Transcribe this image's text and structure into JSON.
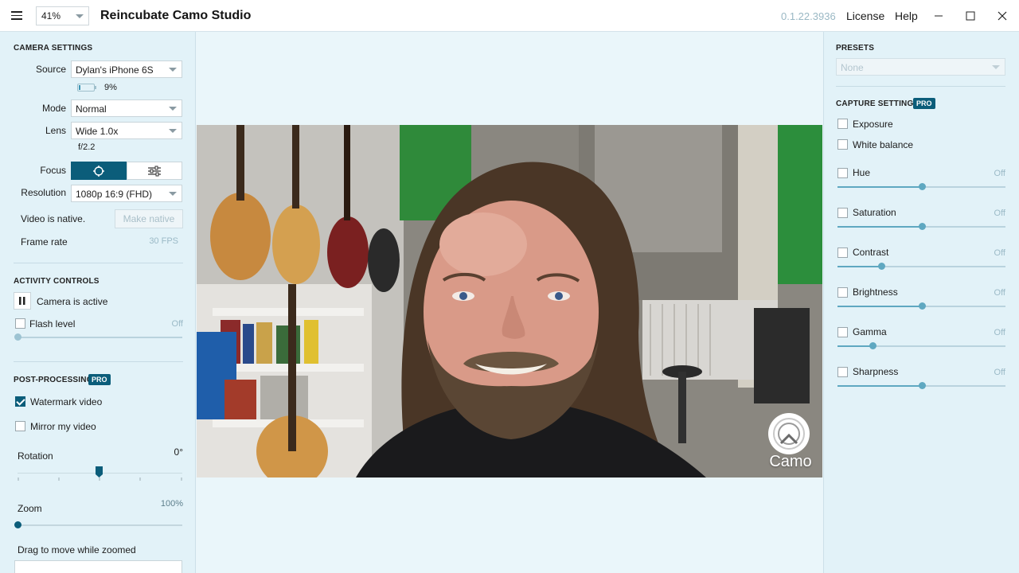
{
  "titlebar": {
    "zoom_value": "41%",
    "app_title": "Reincubate Camo Studio",
    "version": "0.1.22.3936",
    "license_label": "License",
    "help_label": "Help"
  },
  "camera_settings": {
    "title": "Camera Settings",
    "source_label": "Source",
    "source_value": "Dylan's iPhone 6S",
    "battery_percent": "9%",
    "battery_level": 0.09,
    "mode_label": "Mode",
    "mode_value": "Normal",
    "lens_label": "Lens",
    "lens_value": "Wide 1.0x",
    "aperture": "f/2.2",
    "focus_label": "Focus",
    "resolution_label": "Resolution",
    "resolution_value": "1080p 16:9 (FHD)",
    "native_text": "Video is native.",
    "make_native_label": "Make native",
    "frame_rate_label": "Frame rate",
    "frame_rate_value": "30 FPS"
  },
  "activity_controls": {
    "title": "Activity Controls",
    "camera_active_label": "Camera is active",
    "flash_label": "Flash level",
    "flash_value": "Off",
    "flash_level": 0
  },
  "post_processing": {
    "title": "Post-Processing",
    "pro_badge": "PRO",
    "watermark_label": "Watermark video",
    "watermark_checked": true,
    "mirror_label": "Mirror my video",
    "mirror_checked": false,
    "rotation_label": "Rotation",
    "rotation_value": "0°",
    "zoom_label": "Zoom",
    "zoom_value": "100%",
    "drag_label": "Drag to move while zoomed"
  },
  "presets": {
    "title": "Presets",
    "value": "None"
  },
  "capture_settings": {
    "title": "Capture Settings",
    "pro_badge": "PRO",
    "exposure_label": "Exposure",
    "white_balance_label": "White balance",
    "sliders": [
      {
        "label": "Hue",
        "value": "Off",
        "level": 0.5
      },
      {
        "label": "Saturation",
        "value": "Off",
        "level": 0.5
      },
      {
        "label": "Contrast",
        "value": "Off",
        "level": 0.26
      },
      {
        "label": "Brightness",
        "value": "Off",
        "level": 0.5
      },
      {
        "label": "Gamma",
        "value": "Off",
        "level": 0.21
      },
      {
        "label": "Sharpness",
        "value": "Off",
        "level": 0.5
      }
    ]
  },
  "feed": {
    "watermark_text": "Camo"
  },
  "colors": {
    "accent": "#0b5d7a",
    "panel_bg": "#e2f2f8",
    "slider": "#5fa8c1"
  }
}
